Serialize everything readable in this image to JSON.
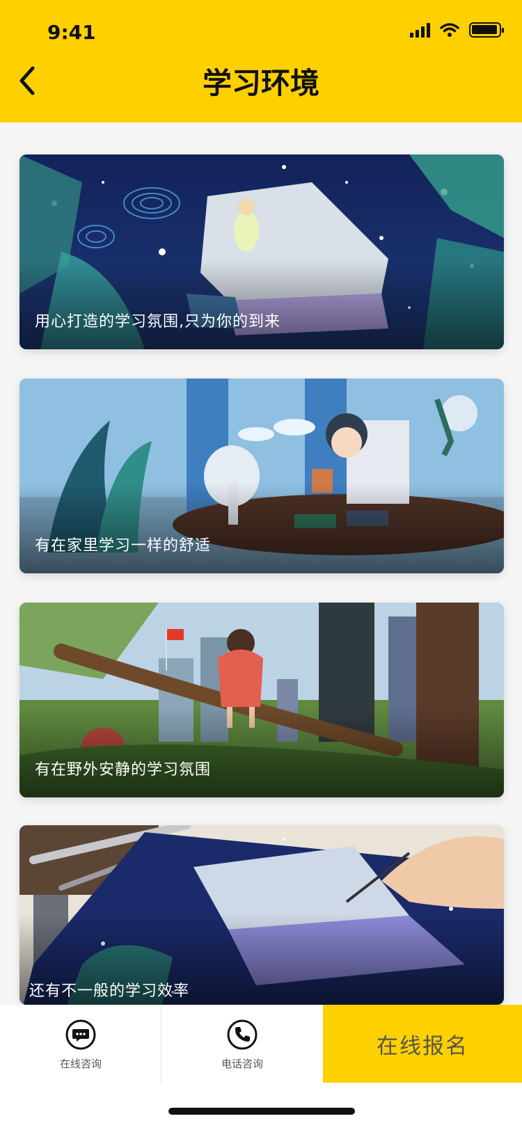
{
  "status_bar": {
    "time": "9:41"
  },
  "header": {
    "title": "学习环境",
    "back_icon": "chevron-left-icon"
  },
  "cards": [
    {
      "caption": "用心打造的学习氛围,只为你的到来"
    },
    {
      "caption": "有在家里学习一样的舒适"
    },
    {
      "caption": "有在野外安静的学习氛围"
    },
    {
      "caption": "还有不一般的学习效率"
    }
  ],
  "bottom_bar": {
    "online_consult_label": "在线咨询",
    "phone_consult_label": "电话咨询",
    "signup_label": "在线报名",
    "online_consult_icon": "chat-bubble-icon",
    "phone_consult_icon": "phone-icon"
  },
  "colors": {
    "accent": "#FFD000",
    "background": "#F5F5F5"
  }
}
